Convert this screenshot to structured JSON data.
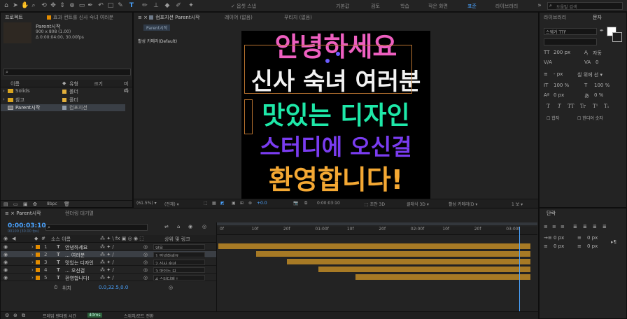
{
  "toolbar": {
    "snap_label": "✓ 옵셋 스냅",
    "workspaces": [
      "기본값",
      "검토",
      "학습",
      "작은 화면",
      "표준",
      "라이브러리"
    ],
    "search_placeholder": "도움말 검색"
  },
  "project": {
    "tab_project": "프로젝트",
    "tab_effects": "효과 컨트롤 신사 숙녀 여러분",
    "comp_name": "Parent시작",
    "comp_size": "900 x 808 (1.00)",
    "comp_duration": "Δ 0:00:04:00, 30.00fps",
    "col_name": "이름",
    "col_type": "유형",
    "col_size": "크기",
    "col_media": "미디",
    "items": [
      {
        "name": "Solids",
        "type": "폴더",
        "icon": "folder-icon"
      },
      {
        "name": "참고",
        "type": "폴더",
        "icon": "folder-icon"
      },
      {
        "name": "Parent시작",
        "type": "컴포지션",
        "icon": "composition-icon"
      }
    ],
    "bpc": "8bpc"
  },
  "viewer": {
    "tab_comp": "컴포지션 Parent시작",
    "tab_layer": "레이어 (없음)",
    "tab_footage": "푸티지 (없음)",
    "comp_chip": "Parent시작",
    "camera_label": "활성 카메라(Default)",
    "lines": [
      {
        "text": "안녕하세요",
        "color": "#ee5fc0"
      },
      {
        "text": "신사 숙녀 여러분",
        "color": "#f2f2f2"
      },
      {
        "text": "맛있는 디자인",
        "color": "#1ee8a8"
      },
      {
        "text": "스터디에 오신걸",
        "color": "#7a3cf0"
      },
      {
        "text": "환영합니다!",
        "color": "#f4a833"
      }
    ],
    "zoom": "(61.5%)",
    "resolution": "(전체)",
    "exposure": "+0.0",
    "timecode": "0:00:03:10",
    "draft3d": "초안 3D",
    "renderer": "클래식 3D",
    "camera_select": "활성 카메라(D",
    "views": "1 보"
  },
  "right": {
    "tab_library": "라이브러리",
    "tab_char": "문자",
    "font_name": "스웨거 TTF",
    "font_size": "200 px",
    "leading": "자동",
    "tracking": "0",
    "stroke": "- px",
    "stroke_mode": "칠 위에 선",
    "vscale": "100 %",
    "hscale": "100 %",
    "baseline": "0 px",
    "tsume": "0 %",
    "style_buttons": [
      "T",
      "T",
      "TT",
      "Tr",
      "T¹",
      "T₁"
    ],
    "ligature": "합자",
    "hindi": "힌디어 숫자",
    "para_tab": "단락",
    "para_values": [
      "0 px",
      "0 px",
      "0 px",
      "0 px",
      "0 px"
    ]
  },
  "timeline": {
    "tab_comp": "Parent시작",
    "tab_render": "렌더링 대기열",
    "timecode": "0:00:03:10",
    "fps_label": "00100 (30.00 fps)",
    "search_placeholder": "",
    "col_source": "소스 이름",
    "col_parent": "상위 및 링크",
    "time_ticks": [
      "0f",
      "10f",
      "20f",
      "01:00f",
      "10f",
      "20f",
      "02:00f",
      "10f",
      "20f",
      "03:00f"
    ],
    "layers": [
      {
        "num": "1",
        "name": "안녕하세요",
        "parent": "없음",
        "start": 0.0
      },
      {
        "num": "2",
        "name": "... 여러분",
        "parent": "1.안녕하세요",
        "start": 0.12
      },
      {
        "num": "3",
        "name": "맛있는 디자인",
        "parent": "2.신사 숙녀",
        "start": 0.22
      },
      {
        "num": "4",
        "name": "... 오신걸",
        "parent": "3.맛있는 디",
        "start": 0.32
      },
      {
        "num": "5",
        "name": "환영합니다!",
        "parent": "4.스터디에 !",
        "start": 0.44
      }
    ],
    "position_label": "위치",
    "position_value": "0.0,32.5,0.0",
    "footer_render": "프레임 렌더링 시간",
    "footer_ms": "40ms",
    "footer_toggle": "스위치/모드 전환",
    "playhead": 0.96
  },
  "colors": {
    "accent": "#4aa3ff",
    "label_orange": "#e38c00",
    "bar": "#a77a25",
    "panel": "#232323",
    "bg": "#1d1d1d"
  }
}
